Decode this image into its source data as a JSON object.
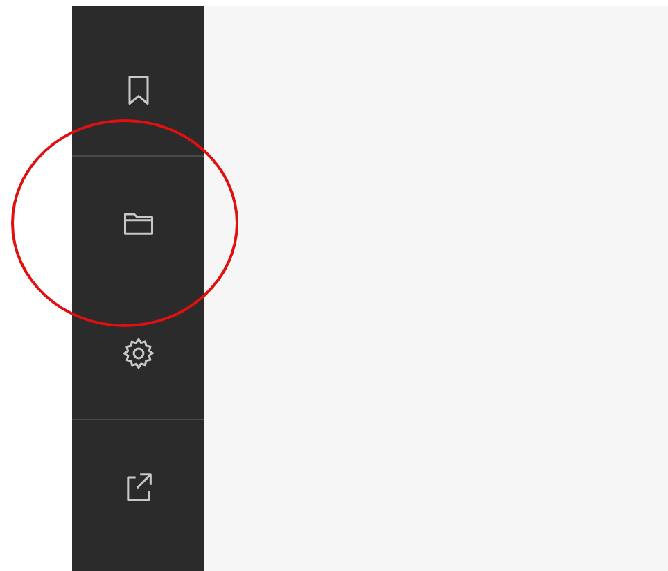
{
  "sidebar": {
    "items": [
      {
        "kind": "bookmark",
        "divider_below": true,
        "highlighted": false
      },
      {
        "kind": "folder",
        "divider_below": false,
        "highlighted": true
      },
      {
        "kind": "settings",
        "divider_below": true,
        "highlighted": false
      },
      {
        "kind": "share",
        "divider_below": false,
        "highlighted": false
      }
    ]
  }
}
